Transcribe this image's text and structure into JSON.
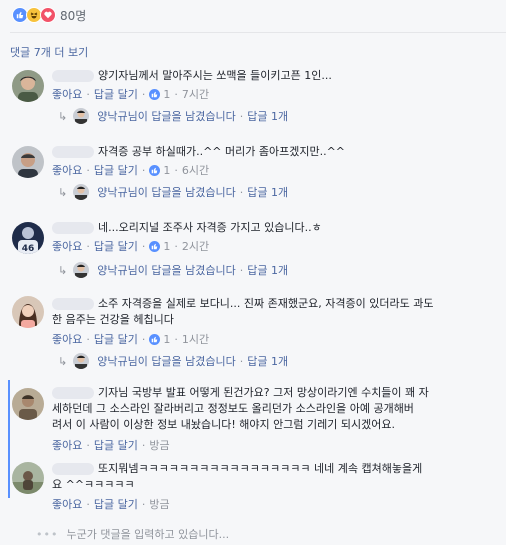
{
  "reactions": {
    "count": "80명"
  },
  "more_link": "댓글 7개 더 보기",
  "comments": [
    {
      "text": "양기자님께서 말아주시는 쏘맥을 들이키고픈 1인...",
      "like_label": "좋아요",
      "reply_label": "답글 달기",
      "like_count": "1",
      "time": "7시간",
      "reply_summary": "양낙규님이 답글을 남겼습니다",
      "reply_count": "답글 1개"
    },
    {
      "text": "자격증 공부 하실때가..^^ 머리가 좀아프겠지만..^^",
      "like_label": "좋아요",
      "reply_label": "답글 달기",
      "like_count": "1",
      "time": "6시간",
      "reply_summary": "양낙규님이 답글을 남겼습니다",
      "reply_count": "답글 1개"
    },
    {
      "text": "네...오리지널 조주사 자격증 가지고 있습니다..ㅎ",
      "like_label": "좋아요",
      "reply_label": "답글 달기",
      "like_count": "1",
      "time": "2시간",
      "reply_summary": "양낙규님이 답글을 남겼습니다",
      "reply_count": "답글 1개"
    },
    {
      "line1": "소주 자격증을 실제로 보다니... 진짜 존재했군요, 자격증이 있더라도 과도",
      "line2": "한 음주는 건강을 헤칩니다",
      "like_label": "좋아요",
      "reply_label": "답글 달기",
      "like_count": "1",
      "time": "1시간",
      "reply_summary": "양낙규님이 답글을 남겼습니다",
      "reply_count": "답글 1개"
    },
    {
      "line1": "기자님 국방부 발표 어떻게 된건가요? 그저 망상이라기엔 수치들이 꽤 자",
      "line2": "세하던데 그 소스라인 잘라버리고 정정보도 올리던가 소스라인을 아예 공개해버",
      "line3": "려서 이 사람이 이상한 정보 내놨습니다! 해야지 안그럼 기레기 되시겠어요.",
      "like_label": "좋아요",
      "reply_label": "답글 달기",
      "time": "방금"
    },
    {
      "line1": "또지뭐넴ㅋㅋㅋㅋㅋㅋㅋㅋㅋㅋㅋㅋㅋㅋㅋㅋㅋ 네네 계속 캡쳐해놓을게",
      "line2": "요 ^^ㅋㅋㅋㅋㅋ",
      "like_label": "좋아요",
      "reply_label": "답글 달기",
      "time": "방금"
    }
  ],
  "typing_text": "누군가 댓글을 입력하고 있습니다...",
  "colors": {
    "link": "#4b67a1",
    "muted": "#90949c",
    "like_blue": "#5890ff"
  }
}
